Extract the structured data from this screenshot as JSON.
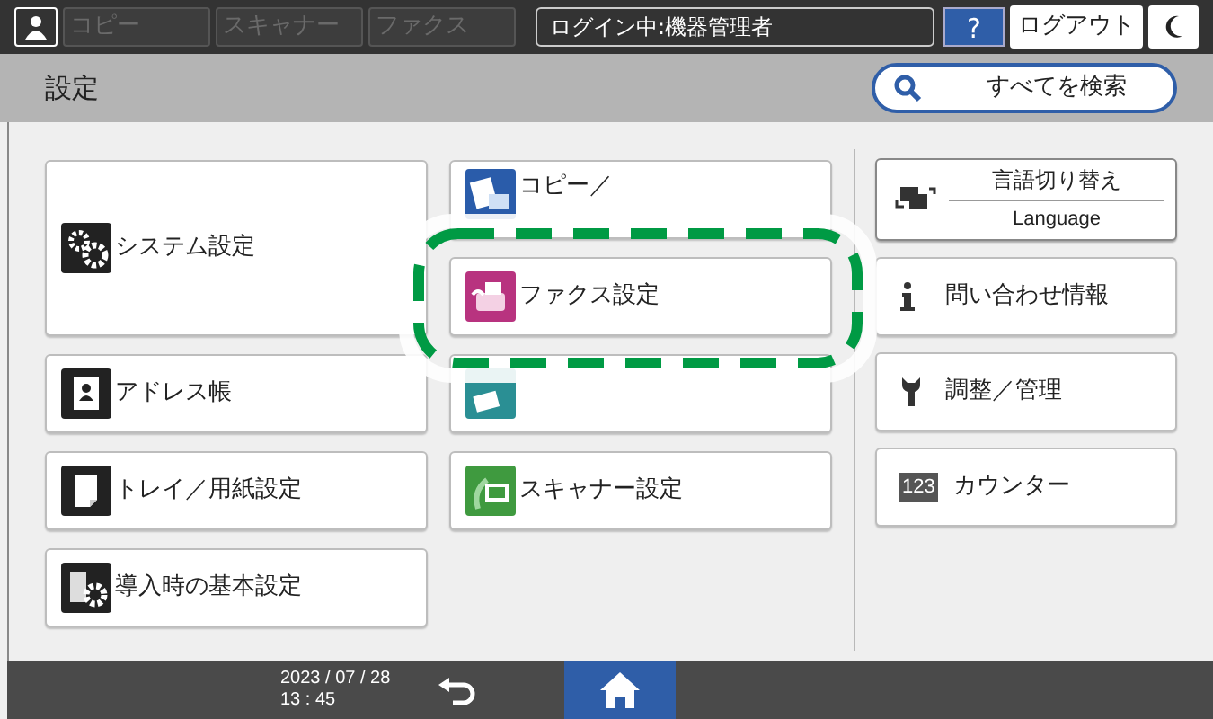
{
  "top_bar": {
    "function_tabs": [
      {
        "label": "コピー",
        "disabled": true
      },
      {
        "label": "スキャナー",
        "disabled": true
      },
      {
        "label": "ファクス",
        "disabled": true
      }
    ],
    "login": "ログイン中:機器管理者",
    "help": "?",
    "logout": "ログアウト"
  },
  "header": {
    "title": "設定",
    "search": "すべてを検索"
  },
  "left_column": [
    {
      "label": "システム設定",
      "kind": "gears",
      "tall": true
    },
    {
      "label": "アドレス帳",
      "kind": "address",
      "tall": false
    },
    {
      "label": "トレイ／用紙設定",
      "kind": "tray",
      "tall": false
    },
    {
      "label": "導入時の基本設定",
      "kind": "setup",
      "tall": false
    }
  ],
  "middle_column": [
    {
      "label": "コピー／",
      "kind": "copy"
    },
    {
      "label": "ファクス設定",
      "kind": "fax",
      "highlighted": true
    },
    {
      "kind": "printer"
    },
    {
      "label": "スキャナー設定",
      "kind": "scanner"
    }
  ],
  "right_column": [
    {
      "kind": "language",
      "label": "言語切り替え",
      "sublabel": "Language"
    },
    {
      "kind": "info",
      "label": "問い合わせ情報"
    },
    {
      "kind": "wrench",
      "label": "調整／管理"
    },
    {
      "kind": "counter",
      "icon_text": "123",
      "label": "カウンター"
    }
  ],
  "footer": {
    "date": "2023 / 07 / 28",
    "time": "13 : 45",
    "home_selected": true
  }
}
